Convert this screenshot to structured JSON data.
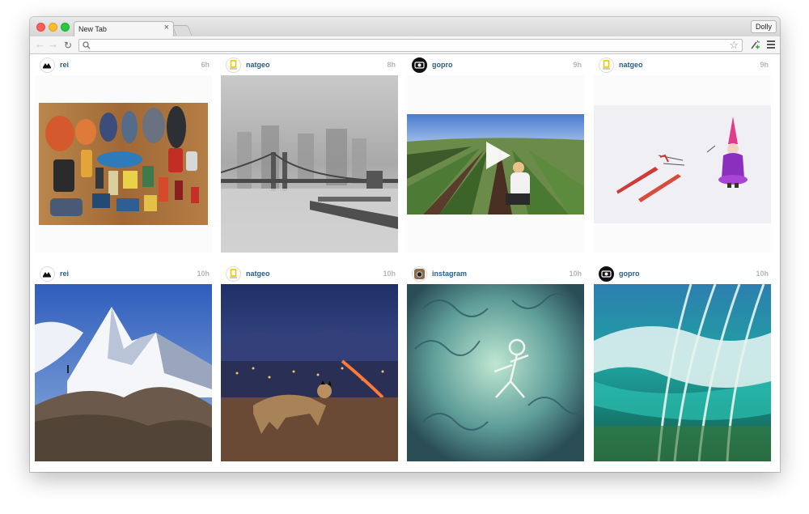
{
  "browser": {
    "tab_title": "New Tab",
    "tab_close": "×",
    "profile_name": "Dolly",
    "omnibox_value": "",
    "icons": {
      "back": "arrow-left-icon",
      "forward": "arrow-right-icon",
      "reload": "reload-icon",
      "search": "search-icon",
      "bookmark": "star-icon",
      "extension": "extension-icon",
      "menu": "hamburger-menu-icon"
    },
    "glyphs": {
      "back": "←",
      "forward": "→",
      "reload": "↻",
      "star": "☆"
    }
  },
  "feed": {
    "accent_username_color": "#2a5d86",
    "timestamp_color": "#b5b5b5",
    "posts": [
      {
        "user": "rei",
        "time": "6h",
        "photo": "gear-flatlay",
        "avatar": "rei-logo"
      },
      {
        "user": "natgeo",
        "time": "8h",
        "photo": "foggy-bridge",
        "avatar": "natgeo-logo"
      },
      {
        "user": "gopro",
        "time": "9h",
        "photo": "strawberry-farm",
        "avatar": "gopro-logo",
        "video": true
      },
      {
        "user": "natgeo",
        "time": "9h",
        "photo": "snow-toys",
        "avatar": "natgeo-logo"
      },
      {
        "user": "rei",
        "time": "10h",
        "photo": "mountain-peak",
        "avatar": "rei-logo"
      },
      {
        "user": "natgeo",
        "time": "10h",
        "photo": "bobcat-city",
        "avatar": "natgeo-logo"
      },
      {
        "user": "instagram",
        "time": "10h",
        "photo": "skeleton-art",
        "avatar": "instagram-logo"
      },
      {
        "user": "gopro",
        "time": "10h",
        "photo": "ocean-wave",
        "avatar": "gopro-logo"
      }
    ]
  }
}
